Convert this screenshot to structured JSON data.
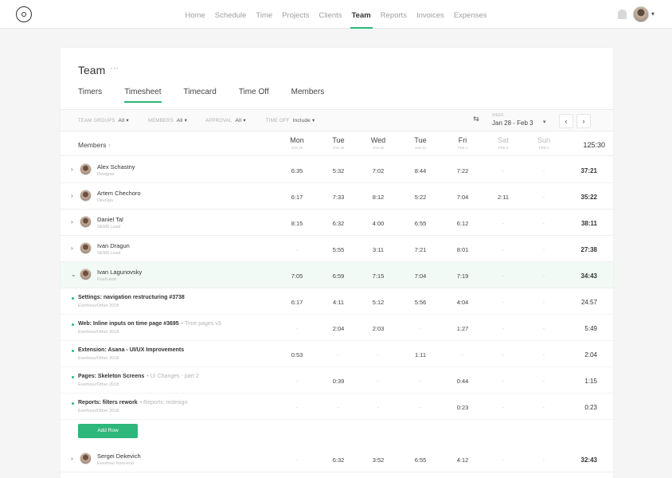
{
  "nav": {
    "items": [
      "Home",
      "Schedule",
      "Time",
      "Projects",
      "Clients",
      "Team",
      "Reports",
      "Invoices",
      "Expenses"
    ],
    "active": "Team"
  },
  "page": {
    "title": "Team",
    "more": "···",
    "tabs": [
      "Timers",
      "Timesheet",
      "Timecard",
      "Time Off",
      "Members"
    ],
    "active_tab": "Timesheet"
  },
  "filters": [
    {
      "label": "TEAM GROUPS",
      "value": "All"
    },
    {
      "label": "MEMBERS",
      "value": "All"
    },
    {
      "label": "APPROVAL",
      "value": "All"
    },
    {
      "label": "TIME OFF",
      "value": "Include"
    }
  ],
  "date_range": {
    "label": "WEEK",
    "value": "Jan 28 - Feb 3"
  },
  "table": {
    "members_header": "Members",
    "sort_icon": "↑",
    "days": [
      {
        "name": "Mon",
        "date": "JAN 28",
        "weekend": false
      },
      {
        "name": "Tue",
        "date": "JAN 29",
        "weekend": false
      },
      {
        "name": "Wed",
        "date": "JAN 30",
        "weekend": false
      },
      {
        "name": "Tue",
        "date": "JAN 31",
        "weekend": false
      },
      {
        "name": "Fri",
        "date": "FEB 1",
        "weekend": false
      },
      {
        "name": "Sat",
        "date": "FEB 2",
        "weekend": true
      },
      {
        "name": "Sun",
        "date": "FEB 3",
        "weekend": true
      }
    ],
    "grand_total": "125:30",
    "members_top": [
      {
        "name": "Alex Schastny",
        "role": "Designer",
        "times": [
          "6:35",
          "5:32",
          "7:02",
          "8:44",
          "7:22",
          "-",
          "-"
        ],
        "total": "37:21"
      },
      {
        "name": "Artem Chechoro",
        "role": "DevOps",
        "times": [
          "6:17",
          "7:33",
          "8:12",
          "5:22",
          "7:04",
          "2:11",
          "-"
        ],
        "total": "35:22"
      },
      {
        "name": "Daniel Tal",
        "role": "SEMS Lead",
        "times": [
          "8:15",
          "6:32",
          "4:00",
          "6:55",
          "6:12",
          "-",
          "-"
        ],
        "total": "38:11"
      },
      {
        "name": "Ivan Dragun",
        "role": "SEMS Lead",
        "times": [
          "-",
          "5:55",
          "3:11",
          "7:21",
          "8:01",
          "-",
          "-"
        ],
        "total": "27:38"
      },
      {
        "name": "Ivan Lagunovsky",
        "role": "Front-end",
        "times": [
          "7:05",
          "6:59",
          "7:15",
          "7:04",
          "7:19",
          "-",
          "-"
        ],
        "total": "34:43"
      }
    ],
    "tasks": [
      {
        "name": "Settings: navigation restructuring #3738",
        "sub": "",
        "project": "Everhour/Other 2018",
        "times": [
          "6:17",
          "4:11",
          "5:12",
          "5:56",
          "4:04",
          "-",
          "-"
        ],
        "total": "24:57"
      },
      {
        "name": "Web: Inline inputs on time page #3695",
        "sub": "• Time pages v3",
        "project": "Everhour/Other 2018",
        "times": [
          "-",
          "2:04",
          "2:03",
          "-",
          "1:27",
          "-",
          "-"
        ],
        "total": "5:49"
      },
      {
        "name": "Extension: Asana - UI/UX Improvements",
        "sub": "",
        "project": "Everhour/Other 2018",
        "times": [
          "0:53",
          "-",
          "-",
          "1:11",
          "-",
          "-",
          "-"
        ],
        "total": "2:04"
      },
      {
        "name": "Pages: Skeleton Screens",
        "sub": "• UI Changes - part 2",
        "project": "Everhour/Other 2018",
        "times": [
          "-",
          "0:39",
          "-",
          "-",
          "0:44",
          "-",
          "-"
        ],
        "total": "1:15"
      },
      {
        "name": "Reports: filters rework",
        "sub": "• Reports: redesign",
        "project": "Everhour/Other 2018",
        "times": [
          "-",
          "-",
          "-",
          "-",
          "0:23",
          "-",
          "-"
        ],
        "total": "0:23"
      }
    ],
    "add_row": "Add Row",
    "members_bottom": [
      {
        "name": "Sergei Dekevich",
        "role": "Everhour front-end",
        "times": [
          "-",
          "6:32",
          "3:52",
          "6:55",
          "4:12",
          "-",
          "-"
        ],
        "total": "32:43"
      }
    ]
  }
}
